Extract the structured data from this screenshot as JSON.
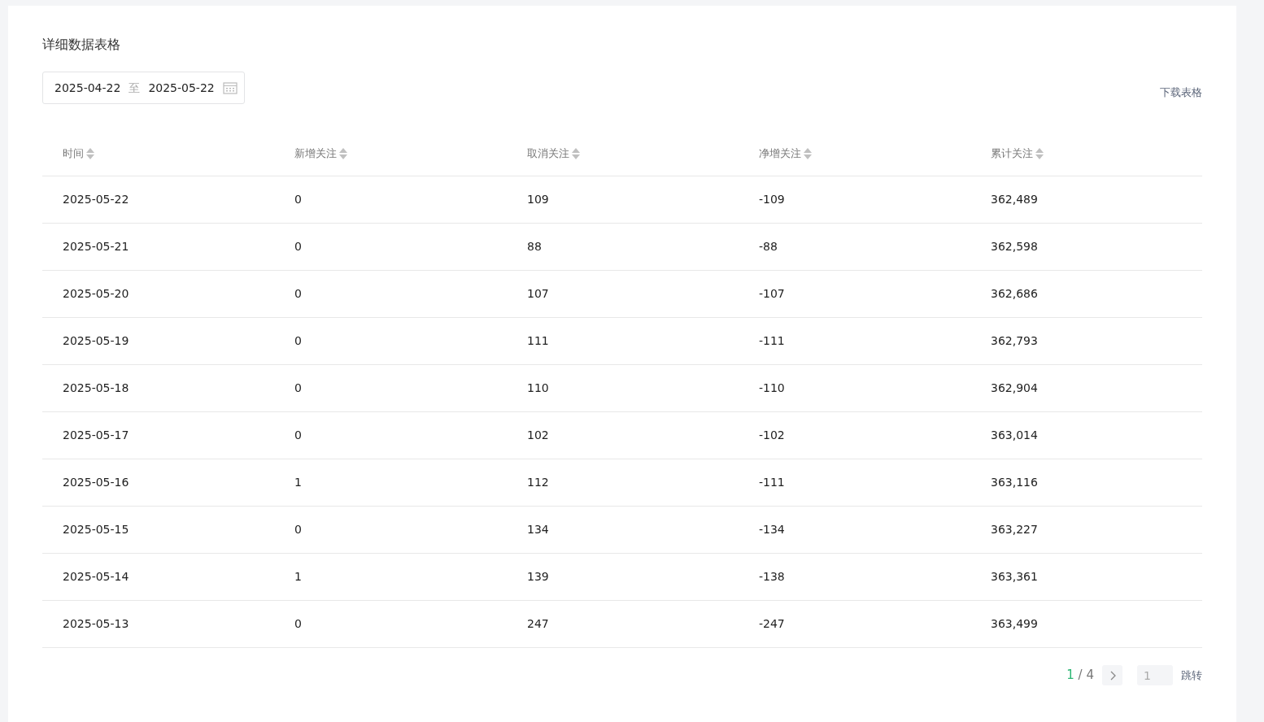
{
  "title": "详细数据表格",
  "date_range": {
    "start": "2025-04-22",
    "separator": "至",
    "end": "2025-05-22"
  },
  "download_link": "下载表格",
  "table": {
    "columns": [
      "时间",
      "新增关注",
      "取消关注",
      "净增关注",
      "累计关注"
    ],
    "rows": [
      [
        "2025-05-22",
        "0",
        "109",
        "-109",
        "362,489"
      ],
      [
        "2025-05-21",
        "0",
        "88",
        "-88",
        "362,598"
      ],
      [
        "2025-05-20",
        "0",
        "107",
        "-107",
        "362,686"
      ],
      [
        "2025-05-19",
        "0",
        "111",
        "-111",
        "362,793"
      ],
      [
        "2025-05-18",
        "0",
        "110",
        "-110",
        "362,904"
      ],
      [
        "2025-05-17",
        "0",
        "102",
        "-102",
        "363,014"
      ],
      [
        "2025-05-16",
        "1",
        "112",
        "-111",
        "363,116"
      ],
      [
        "2025-05-15",
        "0",
        "134",
        "-134",
        "363,227"
      ],
      [
        "2025-05-14",
        "1",
        "139",
        "-138",
        "363,361"
      ],
      [
        "2025-05-13",
        "0",
        "247",
        "-247",
        "363,499"
      ]
    ]
  },
  "pagination": {
    "current": "1",
    "separator": "/",
    "total": "4",
    "jump_placeholder": "1",
    "jump_button": "跳转"
  }
}
